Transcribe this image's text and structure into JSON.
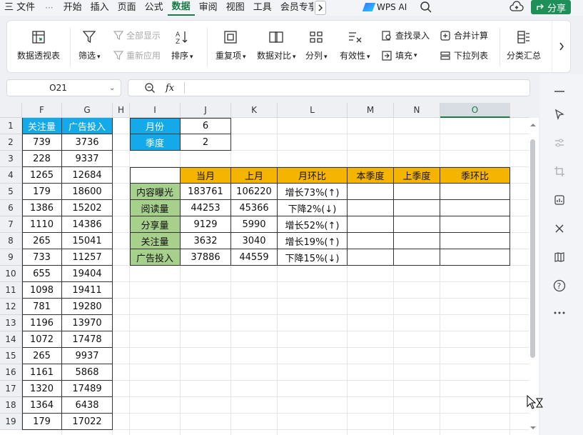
{
  "menu": {
    "file": "三 文件",
    "more": "···",
    "tabs": [
      "开始",
      "插入",
      "页面",
      "公式",
      "数据",
      "审阅",
      "视图",
      "工具",
      "会员专享"
    ],
    "active_tab": "数据",
    "wps_ai": "WPS AI",
    "share": "分享"
  },
  "ribbon": {
    "pivot": "数据透视表",
    "filter": "筛选",
    "show_all": "全部显示",
    "reapply": "重新应用",
    "sort": "排序",
    "duplicates": "重复项",
    "compare": "数据对比",
    "split": "分列",
    "validity": "有效性",
    "find_entry": "查找录入",
    "fill": "填充",
    "merge_calc": "合并计算",
    "dropdown_list": "下拉列表",
    "subtotal": "分类汇总"
  },
  "formula_bar": {
    "name_box": "O21",
    "fx": "fx",
    "zoom_icon": "zoom-icon",
    "value": ""
  },
  "sheet": {
    "columns": [
      "F",
      "G",
      "H",
      "I",
      "J",
      "K",
      "L",
      "M",
      "N",
      "O"
    ],
    "selected_column": "O",
    "rows": [
      "1",
      "2",
      "3",
      "4",
      "5",
      "6",
      "7",
      "8",
      "9",
      "10",
      "11",
      "12",
      "13",
      "14",
      "15",
      "16",
      "17",
      "18",
      "19"
    ],
    "left_table": {
      "headers": [
        "关注量",
        "广告投入"
      ],
      "data": [
        [
          "739",
          "3736"
        ],
        [
          "228",
          "9337"
        ],
        [
          "1265",
          "12684"
        ],
        [
          "179",
          "18600"
        ],
        [
          "1386",
          "15202"
        ],
        [
          "1110",
          "14386"
        ],
        [
          "265",
          "15041"
        ],
        [
          "733",
          "11257"
        ],
        [
          "655",
          "19404"
        ],
        [
          "1098",
          "19411"
        ],
        [
          "781",
          "19280"
        ],
        [
          "1196",
          "13970"
        ],
        [
          "1072",
          "17478"
        ],
        [
          "265",
          "9937"
        ],
        [
          "1161",
          "5868"
        ],
        [
          "1320",
          "17489"
        ],
        [
          "1364",
          "6438"
        ],
        [
          "179",
          "17022"
        ]
      ]
    },
    "params": [
      {
        "label": "月份",
        "value": "6"
      },
      {
        "label": "季度",
        "value": "2"
      }
    ],
    "summary": {
      "headers": [
        "当月",
        "上月",
        "月环比",
        "本季度",
        "上季度",
        "季环比"
      ],
      "rows": [
        {
          "name": "内容曝光",
          "cur": "183761",
          "prev": "106220",
          "mom": "增长73%(↑)",
          "q": "",
          "pq": "",
          "qoq": ""
        },
        {
          "name": "阅读量",
          "cur": "44253",
          "prev": "45366",
          "mom": "下降2%(↓)",
          "q": "",
          "pq": "",
          "qoq": ""
        },
        {
          "name": "分享量",
          "cur": "9129",
          "prev": "5990",
          "mom": "增长52%(↑)",
          "q": "",
          "pq": "",
          "qoq": ""
        },
        {
          "name": "关注量",
          "cur": "3632",
          "prev": "3040",
          "mom": "增长19%(↑)",
          "q": "",
          "pq": "",
          "qoq": ""
        },
        {
          "name": "广告投入",
          "cur": "37886",
          "prev": "44559",
          "mom": "下降15%(↓)",
          "q": "",
          "pq": "",
          "qoq": ""
        }
      ]
    }
  },
  "colors": {
    "accent": "#1a7b47",
    "header_blue": "#14a9e8",
    "header_orange": "#f4b400",
    "header_green": "#a8d08d"
  }
}
